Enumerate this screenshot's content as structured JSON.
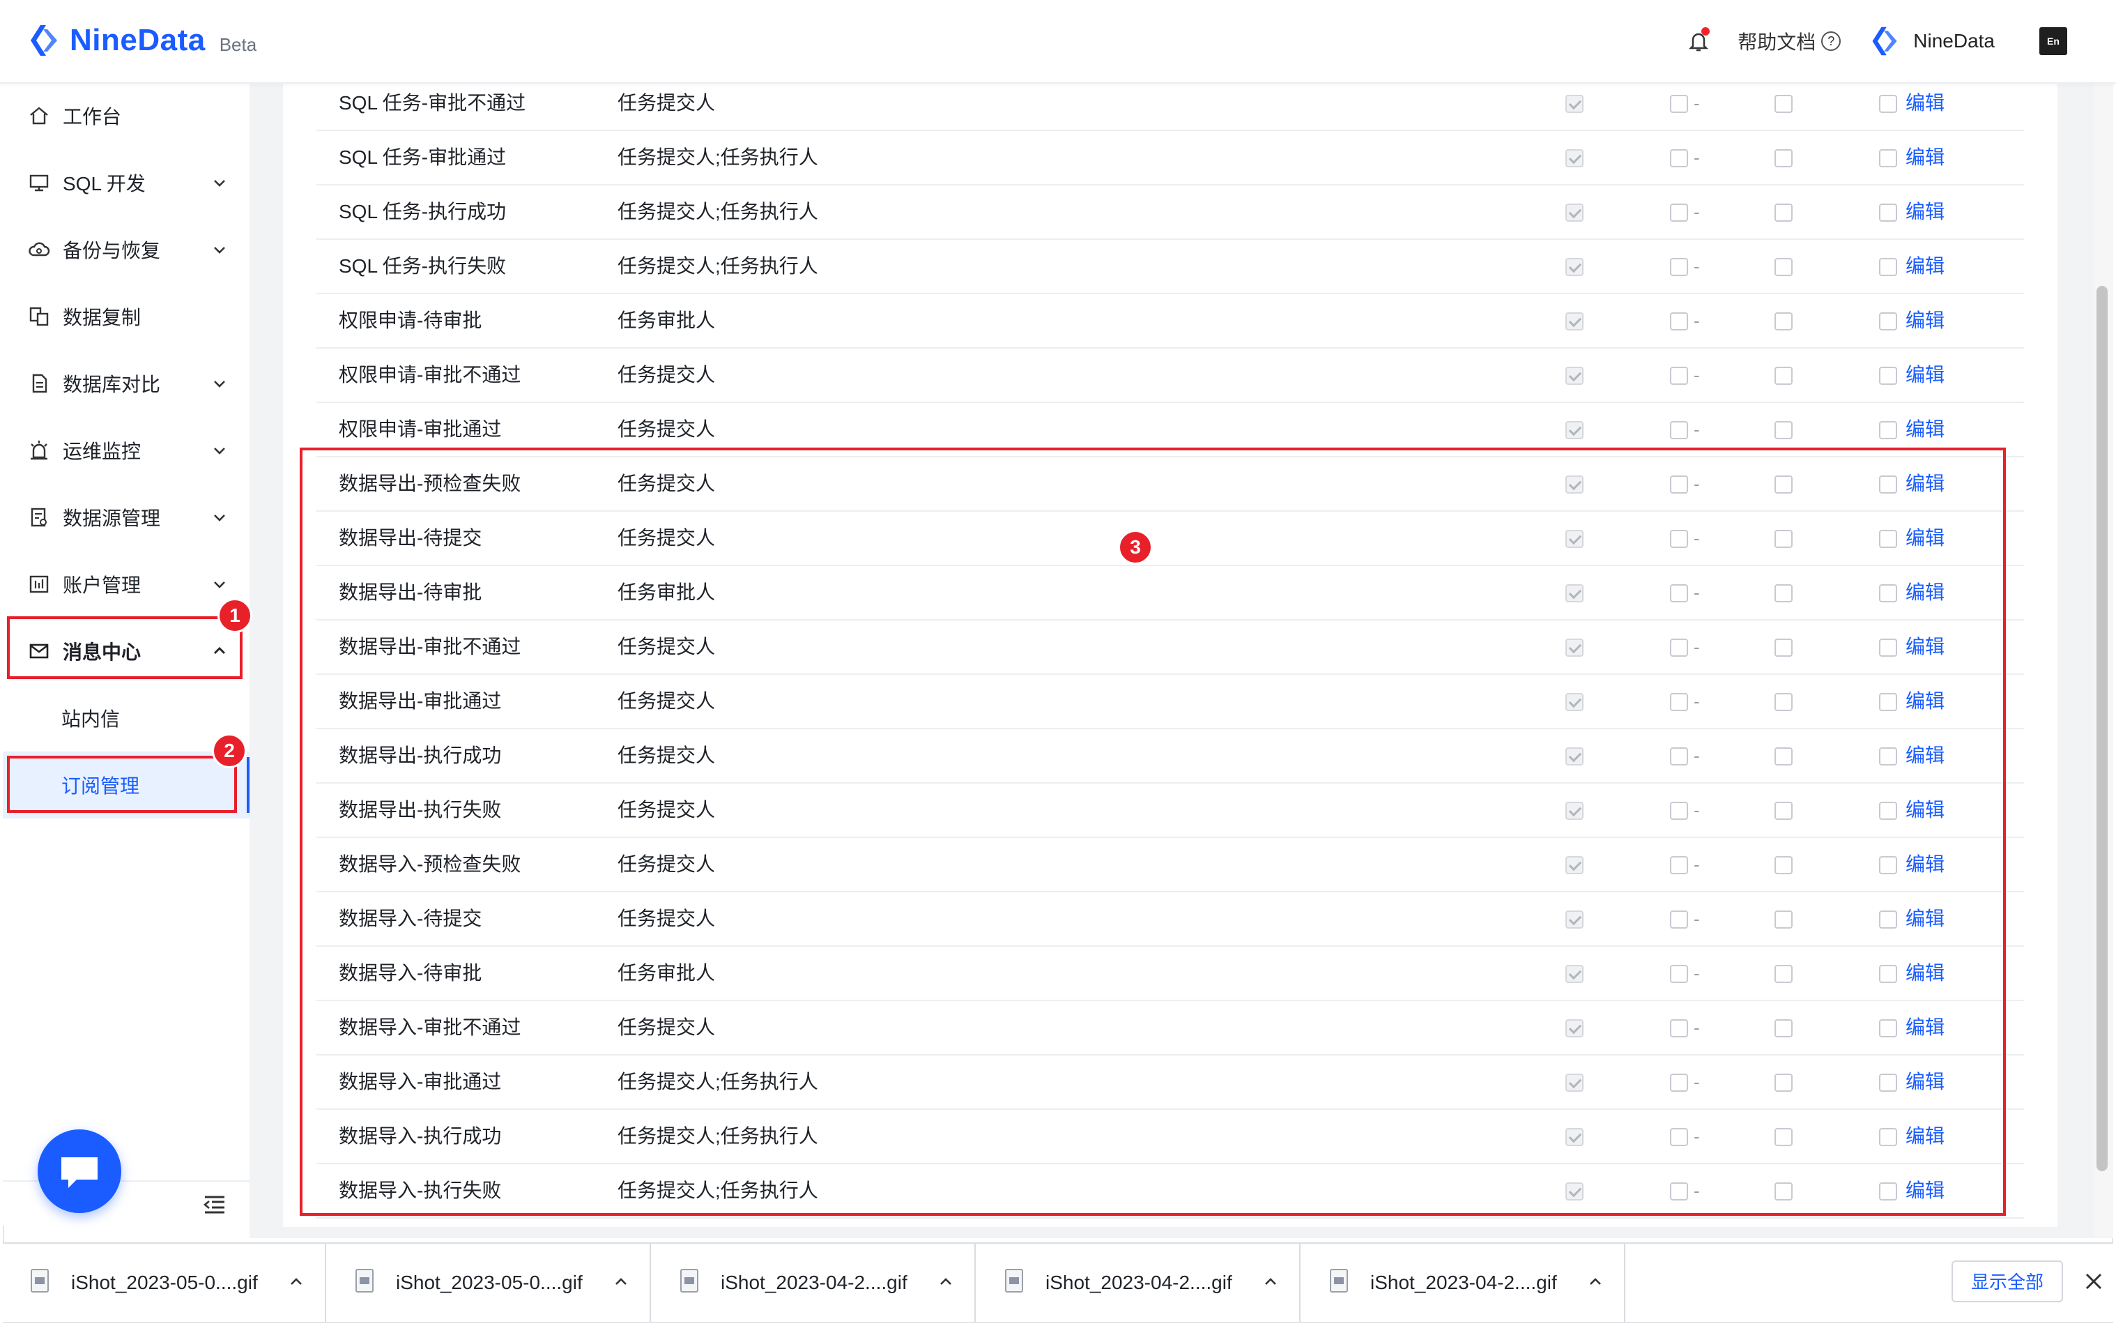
{
  "app": {
    "name": "NineData",
    "badge": "Beta"
  },
  "header": {
    "help_label": "帮助文档",
    "user_name": "NineData",
    "lang_icon": "En"
  },
  "sidebar": {
    "items": [
      {
        "label": "工作台",
        "icon": "home-icon",
        "has_chevron": false
      },
      {
        "label": "SQL 开发",
        "icon": "monitor-icon",
        "has_chevron": true
      },
      {
        "label": "备份与恢复",
        "icon": "cloud-backup-icon",
        "has_chevron": true
      },
      {
        "label": "数据复制",
        "icon": "copy-database-icon",
        "has_chevron": false
      },
      {
        "label": "数据库对比",
        "icon": "compare-doc-icon",
        "has_chevron": true
      },
      {
        "label": "运维监控",
        "icon": "alarm-icon",
        "has_chevron": true
      },
      {
        "label": "数据源管理",
        "icon": "datasource-icon",
        "has_chevron": true
      },
      {
        "label": "账户管理",
        "icon": "account-icon",
        "has_chevron": true
      },
      {
        "label": "消息中心",
        "icon": "mail-icon",
        "has_chevron": true,
        "expanded": true
      },
      {
        "label": "站内信",
        "sub": true
      },
      {
        "label": "订阅管理",
        "sub": true,
        "active": true
      }
    ]
  },
  "table": {
    "rows": [
      {
        "name": "SQL 任务-审批不通过",
        "role": "任务提交人",
        "action": "编辑"
      },
      {
        "name": "SQL 任务-审批通过",
        "role": "任务提交人;任务执行人",
        "action": "编辑"
      },
      {
        "name": "SQL 任务-执行成功",
        "role": "任务提交人;任务执行人",
        "action": "编辑"
      },
      {
        "name": "SQL 任务-执行失败",
        "role": "任务提交人;任务执行人",
        "action": "编辑"
      },
      {
        "name": "权限申请-待审批",
        "role": "任务审批人",
        "action": "编辑"
      },
      {
        "name": "权限申请-审批不通过",
        "role": "任务提交人",
        "action": "编辑"
      },
      {
        "name": "权限申请-审批通过",
        "role": "任务提交人",
        "action": "编辑"
      },
      {
        "name": "数据导出-预检查失败",
        "role": "任务提交人",
        "action": "编辑"
      },
      {
        "name": "数据导出-待提交",
        "role": "任务提交人",
        "action": "编辑"
      },
      {
        "name": "数据导出-待审批",
        "role": "任务审批人",
        "action": "编辑"
      },
      {
        "name": "数据导出-审批不通过",
        "role": "任务提交人",
        "action": "编辑"
      },
      {
        "name": "数据导出-审批通过",
        "role": "任务提交人",
        "action": "编辑"
      },
      {
        "name": "数据导出-执行成功",
        "role": "任务提交人",
        "action": "编辑"
      },
      {
        "name": "数据导出-执行失败",
        "role": "任务提交人",
        "action": "编辑"
      },
      {
        "name": "数据导入-预检查失败",
        "role": "任务提交人",
        "action": "编辑"
      },
      {
        "name": "数据导入-待提交",
        "role": "任务提交人",
        "action": "编辑"
      },
      {
        "name": "数据导入-待审批",
        "role": "任务审批人",
        "action": "编辑"
      },
      {
        "name": "数据导入-审批不通过",
        "role": "任务提交人",
        "action": "编辑"
      },
      {
        "name": "数据导入-审批通过",
        "role": "任务提交人;任务执行人",
        "action": "编辑"
      },
      {
        "name": "数据导入-执行成功",
        "role": "任务提交人;任务执行人",
        "action": "编辑"
      },
      {
        "name": "数据导入-执行失败",
        "role": "任务提交人;任务执行人",
        "action": "编辑"
      }
    ],
    "placeholder_dash": "-"
  },
  "annotations": {
    "badge1": "1",
    "badge2": "2",
    "badge3": "3",
    "color": "#e8202a"
  },
  "downloads": {
    "items": [
      {
        "name": "iShot_2023-05-0....gif"
      },
      {
        "name": "iShot_2023-05-0....gif"
      },
      {
        "name": "iShot_2023-04-2....gif"
      },
      {
        "name": "iShot_2023-04-2....gif"
      },
      {
        "name": "iShot_2023-04-2....gif"
      }
    ],
    "show_all": "显示全部"
  },
  "colors": {
    "brand": "#1a5cff",
    "active_bg": "#e8f1ff",
    "highlight": "#e8202a"
  }
}
